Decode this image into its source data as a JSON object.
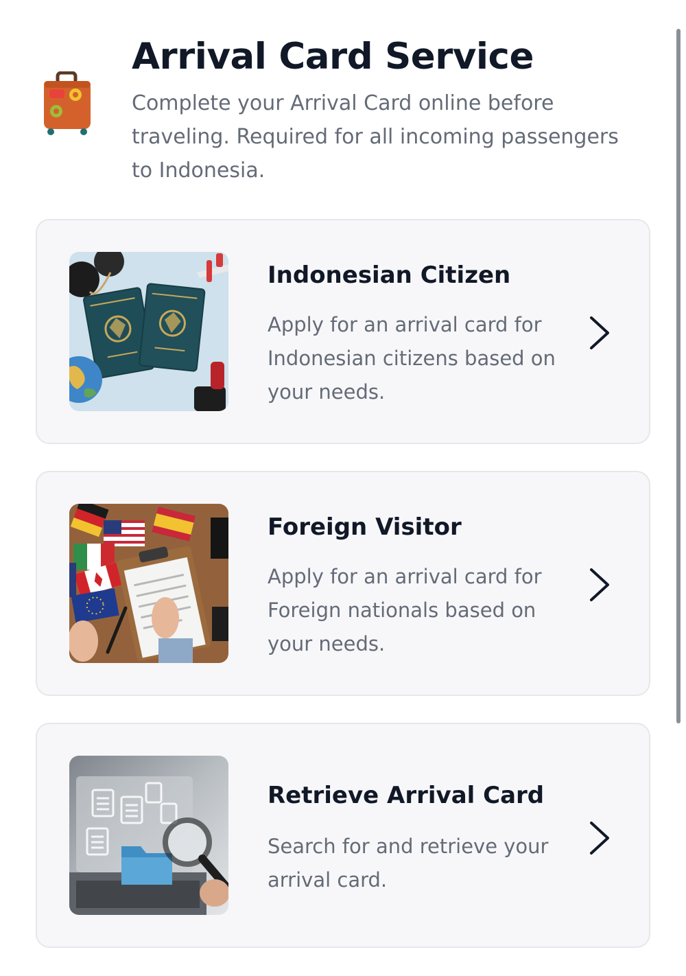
{
  "header": {
    "title": "Arrival Card Service",
    "subtitle": "Complete your Arrival Card online before traveling. Required for all incoming passengers to Indonesia.",
    "icon": "suitcase-icon"
  },
  "options": [
    {
      "title": "Indonesian Citizen",
      "description": "Apply for an arrival card for Indonesian citizens based on your needs.",
      "image": "passports-photo",
      "icon": "chevron-right-icon"
    },
    {
      "title": "Foreign Visitor",
      "description": "Apply for an arrival card for Foreign nationals based on your needs.",
      "image": "flags-clipboard-photo",
      "icon": "chevron-right-icon"
    },
    {
      "title": "Retrieve Arrival Card",
      "description": "Search for and retrieve your arrival card.",
      "image": "document-search-photo",
      "icon": "chevron-right-icon"
    }
  ],
  "colors": {
    "title": "#111827",
    "text_muted": "#646b77",
    "card_background": "#f7f7f9",
    "card_border": "#e6e7eb",
    "suitcase": "#d4612c"
  }
}
